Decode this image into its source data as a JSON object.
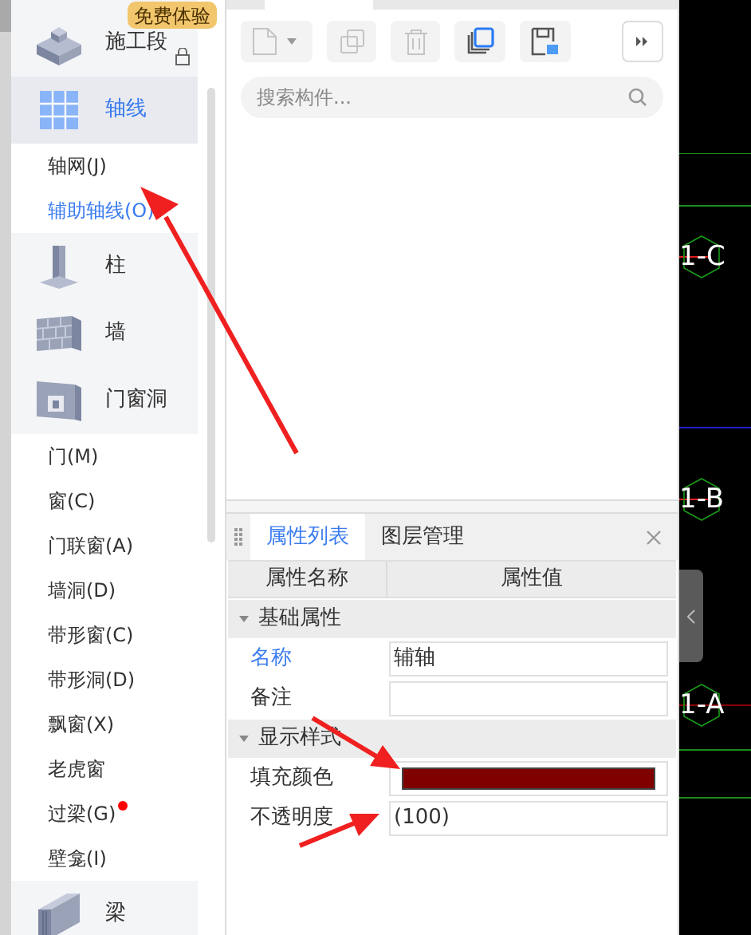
{
  "sidebar": {
    "badge": "免费体验",
    "items": [
      {
        "kind": "category",
        "label": "施工段",
        "selected": false,
        "locked": true
      },
      {
        "kind": "category",
        "label": "轴线",
        "selected": true
      },
      {
        "kind": "item",
        "label": "轴网(J)",
        "selected": false
      },
      {
        "kind": "item",
        "label": "辅助轴线(O)",
        "selected": true
      },
      {
        "kind": "category",
        "label": "柱",
        "selected": false
      },
      {
        "kind": "category",
        "label": "墙",
        "selected": false
      },
      {
        "kind": "category",
        "label": "门窗洞",
        "selected": false
      },
      {
        "kind": "item",
        "label": "门(M)",
        "selected": false
      },
      {
        "kind": "item",
        "label": "窗(C)",
        "selected": false
      },
      {
        "kind": "item",
        "label": "门联窗(A)",
        "selected": false
      },
      {
        "kind": "item",
        "label": "墙洞(D)",
        "selected": false
      },
      {
        "kind": "item",
        "label": "带形窗(C)",
        "selected": false
      },
      {
        "kind": "item",
        "label": "带形洞(D)",
        "selected": false
      },
      {
        "kind": "item",
        "label": "飘窗(X)",
        "selected": false
      },
      {
        "kind": "item",
        "label": "老虎窗",
        "selected": false
      },
      {
        "kind": "item",
        "label": "过梁(G)",
        "selected": false,
        "dot": true
      },
      {
        "kind": "item",
        "label": "壁龛(I)",
        "selected": false
      },
      {
        "kind": "category",
        "label": "梁",
        "selected": false
      }
    ]
  },
  "component_panel": {
    "search": {
      "placeholder": "搜索构件..."
    }
  },
  "property_panel": {
    "tabs": [
      {
        "label": "属性列表",
        "selected": true
      },
      {
        "label": "图层管理",
        "selected": false
      }
    ],
    "columns": [
      "属性名称",
      "属性值"
    ],
    "groups": [
      {
        "label": "基础属性",
        "expanded": true,
        "rows": [
          {
            "kind": "text",
            "name": "名称",
            "highlighted": true,
            "value": "辅轴"
          },
          {
            "kind": "text",
            "name": "备注",
            "highlighted": false
          }
        ]
      },
      {
        "label": "显示样式",
        "expanded": true,
        "rows": [
          {
            "kind": "color",
            "name": "填充颜色",
            "highlighted": false,
            "color": "#800000"
          },
          {
            "kind": "text",
            "name": "不透明度",
            "highlighted": false,
            "value": "(100)"
          }
        ]
      }
    ]
  },
  "canvas": {
    "axis_labels": [
      "1-C",
      "1-B",
      "1-A"
    ]
  }
}
